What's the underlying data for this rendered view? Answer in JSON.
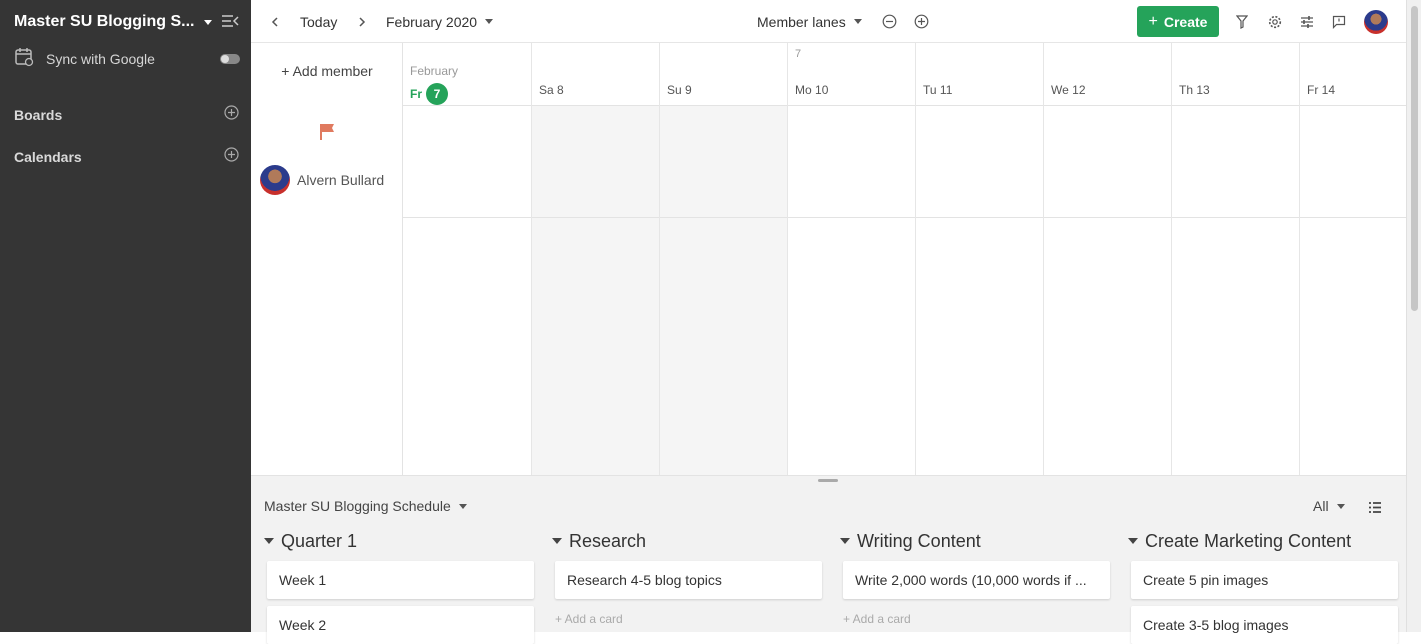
{
  "sidebar": {
    "title": "Master SU Blogging S...",
    "sync_label": "Sync with Google",
    "sections": [
      {
        "label": "Boards"
      },
      {
        "label": "Calendars"
      }
    ]
  },
  "toolbar": {
    "today_label": "Today",
    "month_label": "February 2020",
    "view_label": "Member lanes",
    "create_label": "Create"
  },
  "calendar": {
    "add_member_label": "+ Add member",
    "week_number": "7",
    "month_small": "February",
    "days": [
      {
        "abbr": "Fr",
        "num": "7",
        "today": true
      },
      {
        "abbr": "Sa",
        "num": "8"
      },
      {
        "abbr": "Su",
        "num": "9"
      },
      {
        "abbr": "Mo",
        "num": "10"
      },
      {
        "abbr": "Tu",
        "num": "11"
      },
      {
        "abbr": "We",
        "num": "12"
      },
      {
        "abbr": "Th",
        "num": "13"
      },
      {
        "abbr": "Fr",
        "num": "14"
      }
    ],
    "member_name": "Alvern Bullard"
  },
  "board": {
    "title": "Master SU Blogging Schedule",
    "filter_label": "All",
    "add_card_label": "+ Add a card",
    "lists": [
      {
        "title": "Quarter 1",
        "cards": [
          "Week 1",
          "Week 2"
        ]
      },
      {
        "title": "Research",
        "cards": [
          "Research 4-5 blog topics"
        ]
      },
      {
        "title": "Writing Content",
        "cards": [
          "Write 2,000 words (10,000 words if ..."
        ]
      },
      {
        "title": "Create Marketing Content",
        "cards": [
          "Create 5 pin images",
          "Create 3-5 blog images"
        ]
      }
    ]
  },
  "colors": {
    "accent_green": "#25a35a",
    "sidebar_bg": "#353535",
    "flag": "#e07a5f"
  }
}
